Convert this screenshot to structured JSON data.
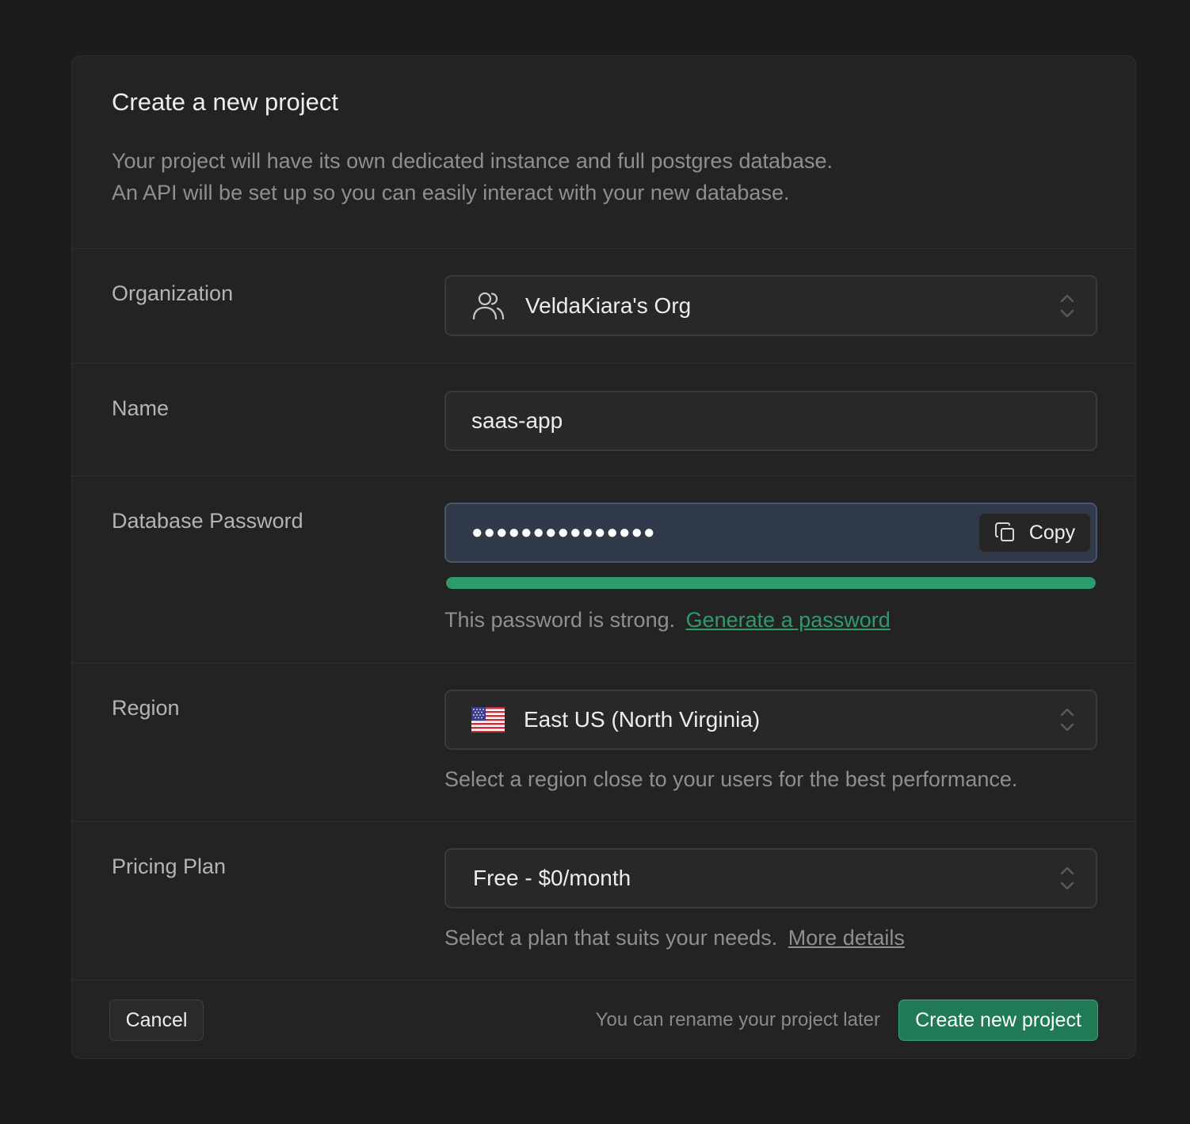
{
  "header": {
    "title": "Create a new project",
    "description_line1": "Your project will have its own dedicated instance and full postgres database.",
    "description_line2": "An API will be set up so you can easily interact with your new database."
  },
  "organization": {
    "label": "Organization",
    "value": "VeldaKiara's Org",
    "icon": "users-icon"
  },
  "name": {
    "label": "Name",
    "value": "saas-app"
  },
  "password": {
    "label": "Database Password",
    "masked_value": "●●●●●●●●●●●●●●●",
    "copy_label": "Copy",
    "strength_fraction": 1.0,
    "strength_color": "#2f9b6b",
    "helper_text": "This password is strong.",
    "generate_link": "Generate a password"
  },
  "region": {
    "label": "Region",
    "value": "East US (North Virginia)",
    "flag": "us-flag-icon",
    "helper_text": "Select a region close to your users for the best performance."
  },
  "plan": {
    "label": "Pricing Plan",
    "value": "Free - $0/month",
    "helper_text": "Select a plan that suits your needs.",
    "details_link": "More details"
  },
  "footer": {
    "cancel_label": "Cancel",
    "note": "You can rename your project later",
    "create_label": "Create new project"
  },
  "colors": {
    "accent": "#2f9b6b",
    "background": "#1c1c1c",
    "panel": "#232323"
  }
}
